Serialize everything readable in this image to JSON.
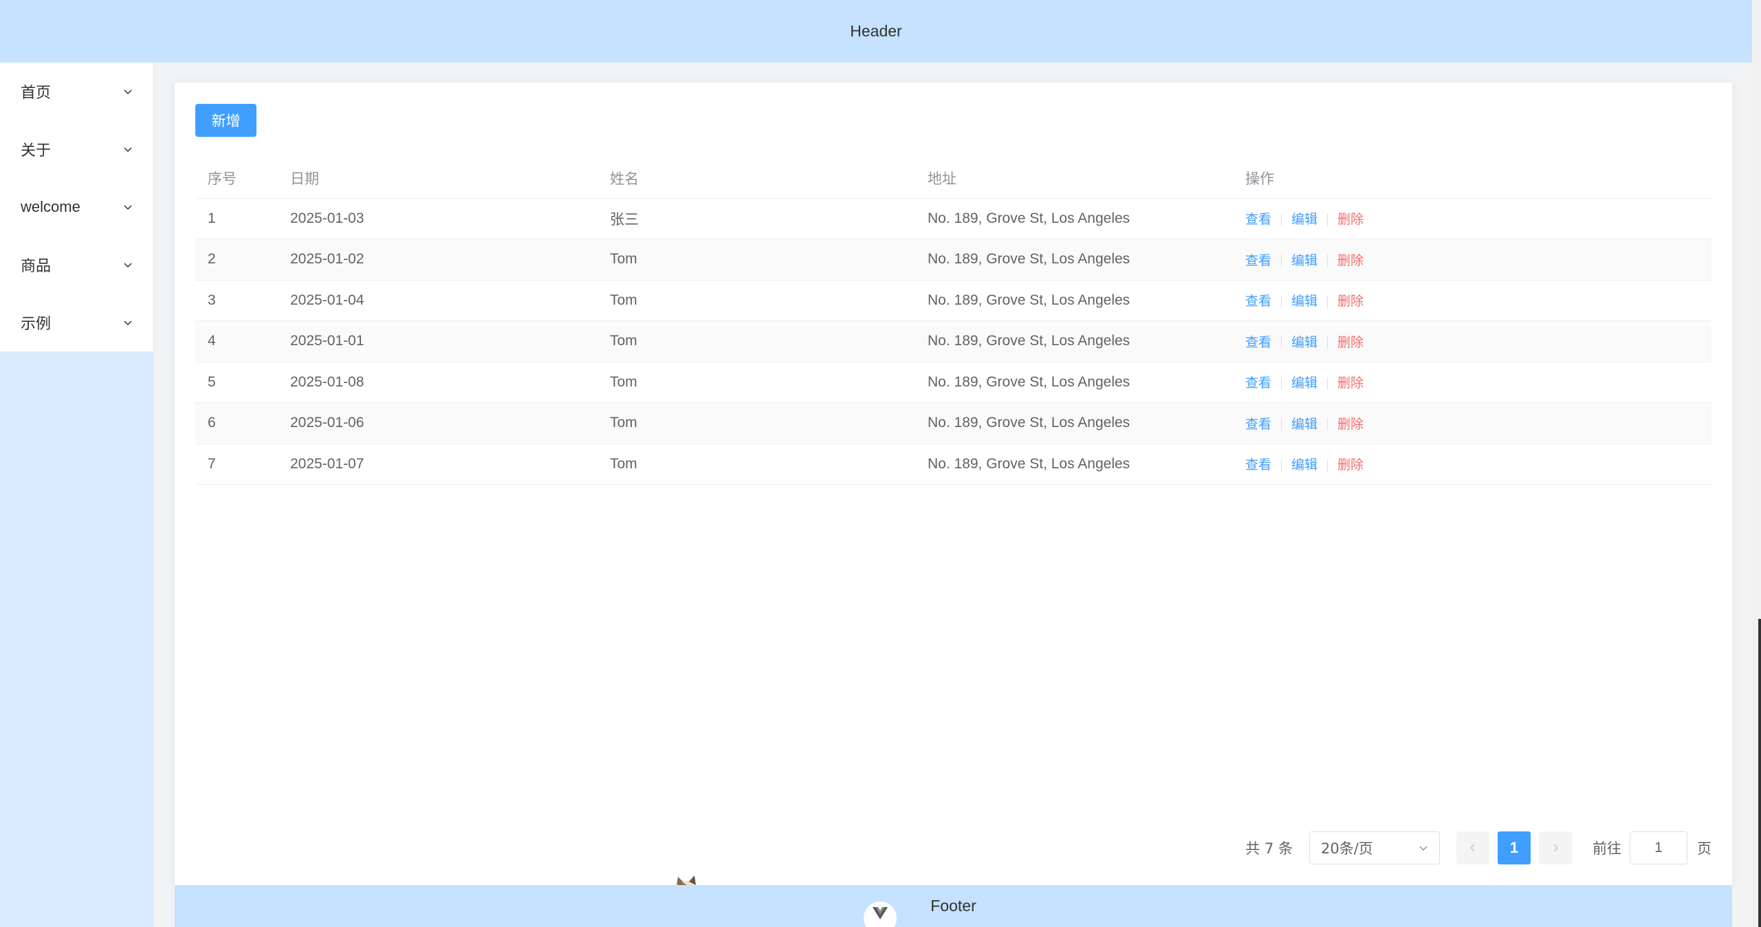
{
  "header": {
    "title": "Header"
  },
  "sidebar": {
    "items": [
      {
        "label": "首页"
      },
      {
        "label": "关于"
      },
      {
        "label": "welcome"
      },
      {
        "label": "商品"
      },
      {
        "label": "示例"
      }
    ]
  },
  "toolbar": {
    "add_label": "新增"
  },
  "table": {
    "headers": {
      "index": "序号",
      "date": "日期",
      "name": "姓名",
      "address": "地址",
      "actions": "操作"
    },
    "rows": [
      {
        "index": "1",
        "date": "2025-01-03",
        "name": "张三",
        "address": "No. 189, Grove St, Los Angeles"
      },
      {
        "index": "2",
        "date": "2025-01-02",
        "name": "Tom",
        "address": "No. 189, Grove St, Los Angeles"
      },
      {
        "index": "3",
        "date": "2025-01-04",
        "name": "Tom",
        "address": "No. 189, Grove St, Los Angeles"
      },
      {
        "index": "4",
        "date": "2025-01-01",
        "name": "Tom",
        "address": "No. 189, Grove St, Los Angeles"
      },
      {
        "index": "5",
        "date": "2025-01-08",
        "name": "Tom",
        "address": "No. 189, Grove St, Los Angeles"
      },
      {
        "index": "6",
        "date": "2025-01-06",
        "name": "Tom",
        "address": "No. 189, Grove St, Los Angeles"
      },
      {
        "index": "7",
        "date": "2025-01-07",
        "name": "Tom",
        "address": "No. 189, Grove St, Los Angeles"
      }
    ],
    "actions": {
      "view": "查看",
      "edit": "编辑",
      "delete": "删除"
    }
  },
  "pagination": {
    "total_text": "共 7 条",
    "page_size": "20条/页",
    "current_page": "1",
    "goto_label": "前往",
    "jump_value": "1",
    "page_unit": "页"
  },
  "footer": {
    "title": "Footer"
  },
  "colors": {
    "primary": "#409eff",
    "danger": "#f56c6c",
    "header_bg": "#c6e2ff",
    "sidebar_bg": "#d9ecff"
  }
}
